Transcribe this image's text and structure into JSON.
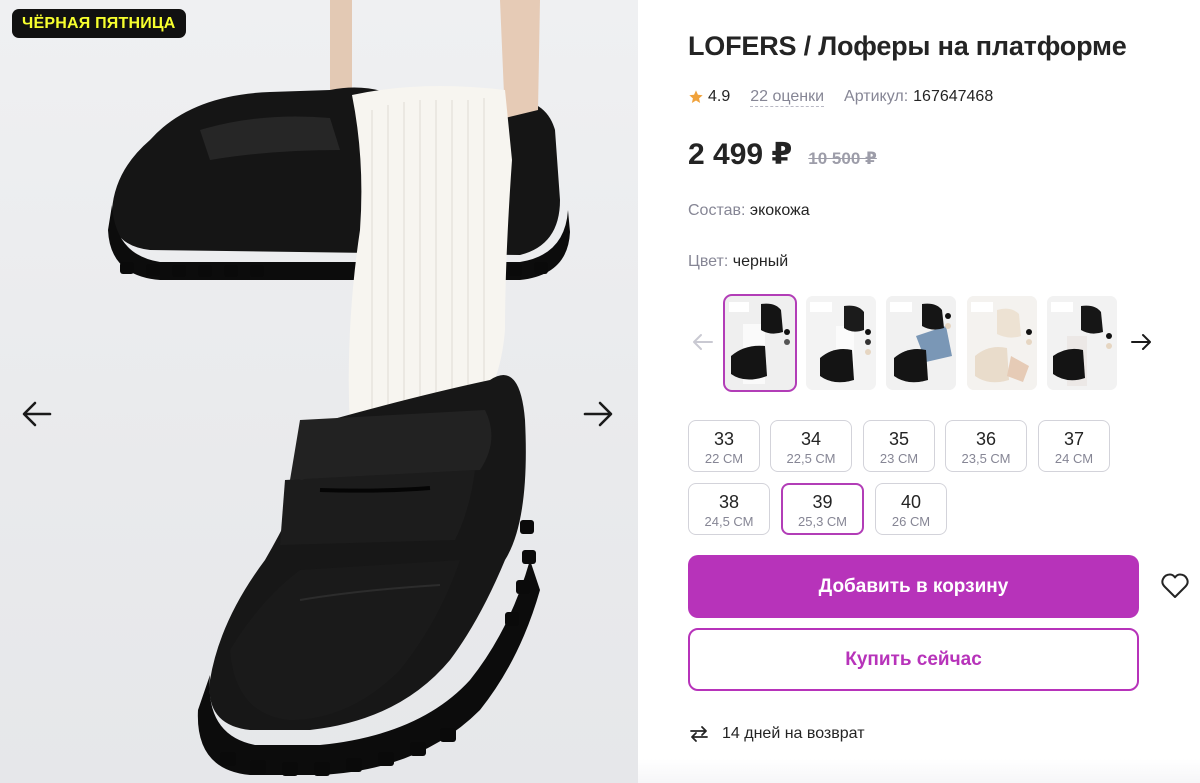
{
  "gallery": {
    "badge": "ЧЁРНАЯ ПЯТНИЦА",
    "prev_icon": "arrow-left-icon",
    "next_icon": "arrow-right-icon"
  },
  "product": {
    "title": "LOFERS / Лоферы на платформе",
    "rating": "4.9",
    "reviews": "22 оценки",
    "article_label": "Артикул:",
    "article_value": "167647468",
    "price": "2 499 ₽",
    "old_price": "10 500 ₽",
    "composition_label": "Состав:",
    "composition_value": "экокожа",
    "color_label": "Цвет:",
    "color_value": "черный"
  },
  "colors": {
    "prev_icon": "arrow-left-icon",
    "next_icon": "arrow-right-icon",
    "items": [
      {
        "name": "black",
        "selected": true
      },
      {
        "name": "black-white",
        "selected": false
      },
      {
        "name": "black-jeans",
        "selected": false
      },
      {
        "name": "beige",
        "selected": false
      },
      {
        "name": "black-lace",
        "selected": false
      }
    ]
  },
  "sizes": [
    {
      "n": "33",
      "cm": "22 СМ",
      "selected": false
    },
    {
      "n": "34",
      "cm": "22,5 СМ",
      "selected": false
    },
    {
      "n": "35",
      "cm": "23 СМ",
      "selected": false
    },
    {
      "n": "36",
      "cm": "23,5 СМ",
      "selected": false
    },
    {
      "n": "37",
      "cm": "24 СМ",
      "selected": false
    },
    {
      "n": "38",
      "cm": "24,5 СМ",
      "selected": false
    },
    {
      "n": "39",
      "cm": "25,3 СМ",
      "selected": true
    },
    {
      "n": "40",
      "cm": "26 СМ",
      "selected": false
    }
  ],
  "actions": {
    "add_to_cart": "Добавить в корзину",
    "buy_now": "Купить сейчас",
    "favorite_icon": "heart-icon"
  },
  "returns": {
    "icon": "return-arrows-icon",
    "text": "14 дней на возврат"
  },
  "colors_theme": {
    "accent": "#b733ba",
    "badge_bg": "#111111",
    "badge_text": "#f7ff2e",
    "star": "#f0a23b",
    "muted": "#868695"
  }
}
